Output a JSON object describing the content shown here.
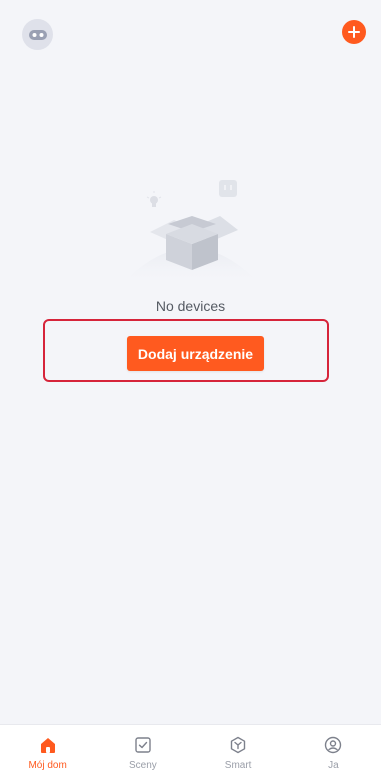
{
  "empty_state": {
    "message": "No devices",
    "add_device_label": "Dodaj urządzenie"
  },
  "bottom_nav": {
    "items": [
      {
        "label": "Mój dom",
        "icon": "home-icon",
        "active": true
      },
      {
        "label": "Sceny",
        "icon": "scenes-icon",
        "active": false
      },
      {
        "label": "Smart",
        "icon": "smart-icon",
        "active": false
      },
      {
        "label": "Ja",
        "icon": "profile-icon",
        "active": false
      }
    ]
  },
  "colors": {
    "accent": "#ff5a1f",
    "background": "#f4f5f9",
    "highlight": "#d6243a",
    "inactive": "#9a9ea8"
  }
}
